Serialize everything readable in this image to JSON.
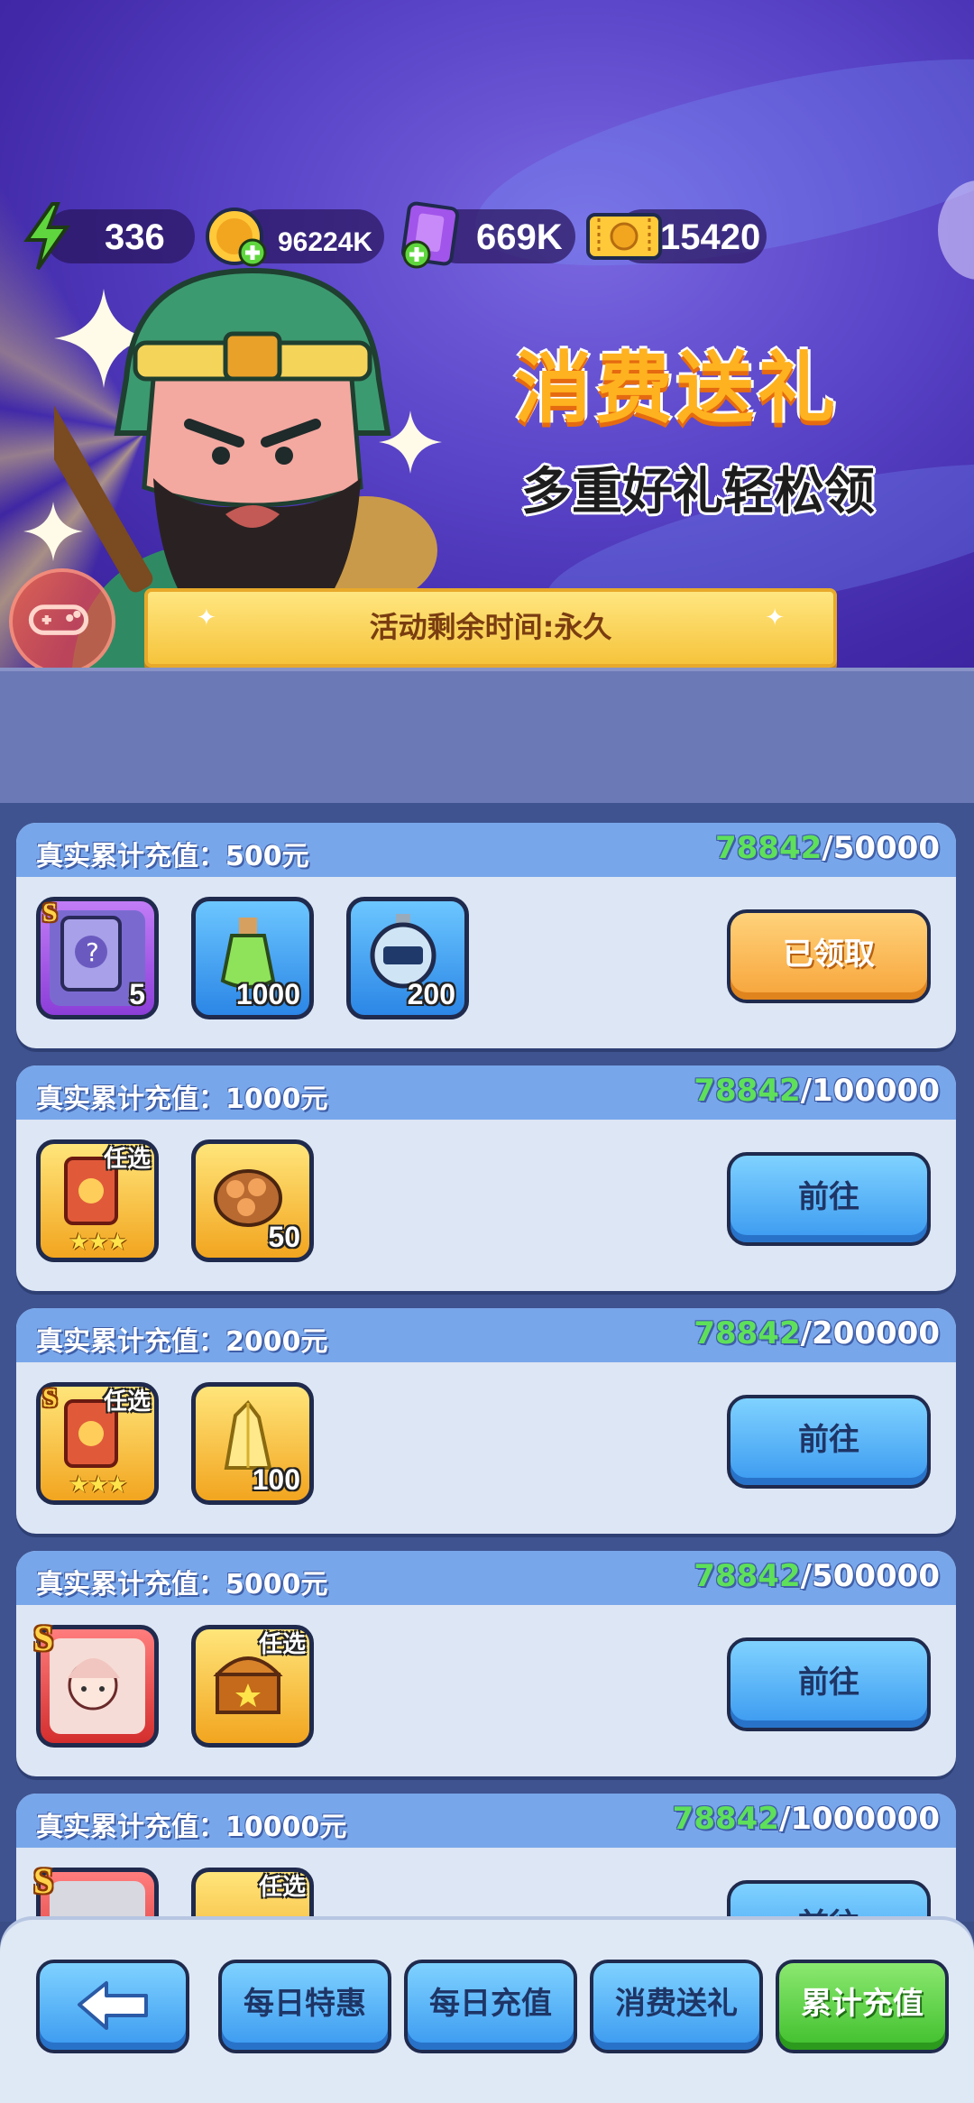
{
  "resources": {
    "energy": "336",
    "gold": "96224K",
    "gems": "669K",
    "tickets": "15420"
  },
  "banner": {
    "title": "消费送礼",
    "subtitle": "多重好礼轻松领",
    "timer": "活动剩余时间:永久"
  },
  "tiers": [
    {
      "title": "真实累计充值：500元",
      "current": "78842",
      "target": "/50000",
      "items": [
        {
          "icon": "s-card-icon",
          "qty": "5"
        },
        {
          "icon": "potion-icon",
          "qty": "1000"
        },
        {
          "icon": "stopwatch-icon",
          "qty": "200"
        }
      ],
      "button": "已领取"
    },
    {
      "title": "真实累计充值：1000元",
      "current": "78842",
      "target": "/100000",
      "items": [
        {
          "icon": "select-card-icon",
          "tag": "任选"
        },
        {
          "icon": "wood-icon",
          "qty": "50"
        }
      ],
      "button": "前往"
    },
    {
      "title": "真实累计充值：2000元",
      "current": "78842",
      "target": "/200000",
      "items": [
        {
          "icon": "s-select-card-icon",
          "tag": "任选"
        },
        {
          "icon": "crystal-icon",
          "qty": "100"
        }
      ],
      "button": "前往"
    },
    {
      "title": "真实累计充值：5000元",
      "current": "78842",
      "target": "/500000",
      "items": [
        {
          "icon": "hero-portrait-icon"
        },
        {
          "icon": "treasure-chest-icon",
          "tag": "任选"
        }
      ],
      "button": "前往"
    },
    {
      "title": "真实累计充值：10000元",
      "current": "78842",
      "target": "/1000000",
      "items": [
        {
          "icon": "hero-portrait-icon"
        },
        {
          "icon": "treasure-chest-icon",
          "tag": "任选"
        }
      ],
      "button": "前往"
    }
  ],
  "nav": {
    "tabs": [
      "每日特惠",
      "每日充值",
      "消费送礼",
      "累计充值"
    ],
    "active": "累计充值"
  }
}
